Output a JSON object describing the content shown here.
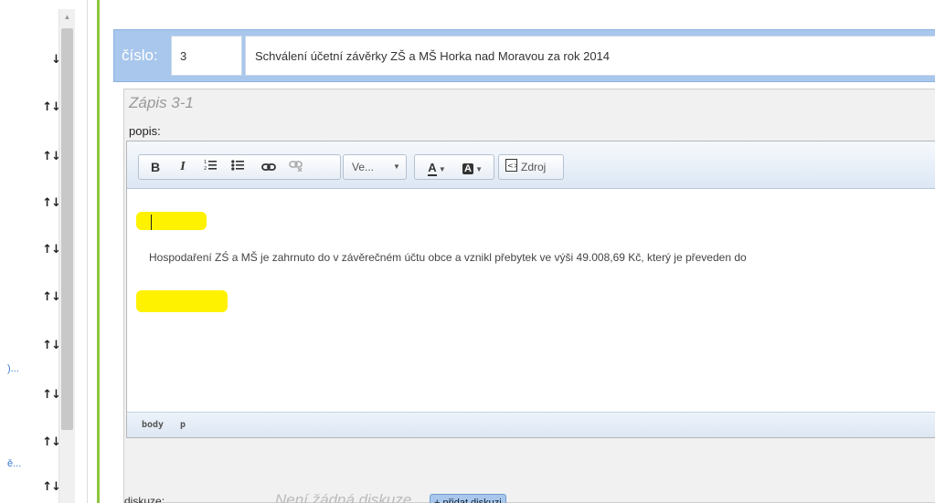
{
  "left_column": {
    "arrows": [
      {
        "label": "↓"
      },
      {
        "label": "↑↓"
      },
      {
        "label": "↑↓"
      },
      {
        "label": "↑↓"
      },
      {
        "label": "↑↓"
      },
      {
        "label": "↑↓"
      },
      {
        "label": "↑↓"
      },
      {
        "label": "↑↓"
      },
      {
        "label": "↑↓"
      },
      {
        "label": "↑↓"
      }
    ],
    "truncated_labels": [
      ")...",
      "ě..."
    ]
  },
  "item": {
    "number_label": "číslo:",
    "number_value": "3",
    "title": "Schválení účetní závěrky ZŠ a MŠ Horka nad Moravou za rok 2014"
  },
  "zapis": {
    "title": "Zápis 3-1",
    "popis_label": "popis:"
  },
  "toolbar": {
    "bold": "B",
    "italic": "I",
    "numbered_list": "numbered-list-icon",
    "bulleted_list": "bulleted-list-icon",
    "link": "link-icon",
    "unlink": "unlink-icon",
    "size_select": "Ve...",
    "text_color": "A",
    "bg_color": "A",
    "source": "Zdroj"
  },
  "editor": {
    "body_text": "Hospodaření ZŚ a MŠ je zahrnuto do v závěrečném účtu obce a vznikl přebytek ve výši 49.008,69 Kč, který je převeden do",
    "highlight_color": "#fff200",
    "path": [
      "body",
      "p"
    ]
  },
  "diskuze": {
    "label": "diskuze:",
    "empty_text": "Není žádná diskuze",
    "add_button": "+ přidat diskuzi"
  },
  "colors": {
    "accent_blue": "#a9c7ec",
    "green_rule": "#8cc63f"
  }
}
